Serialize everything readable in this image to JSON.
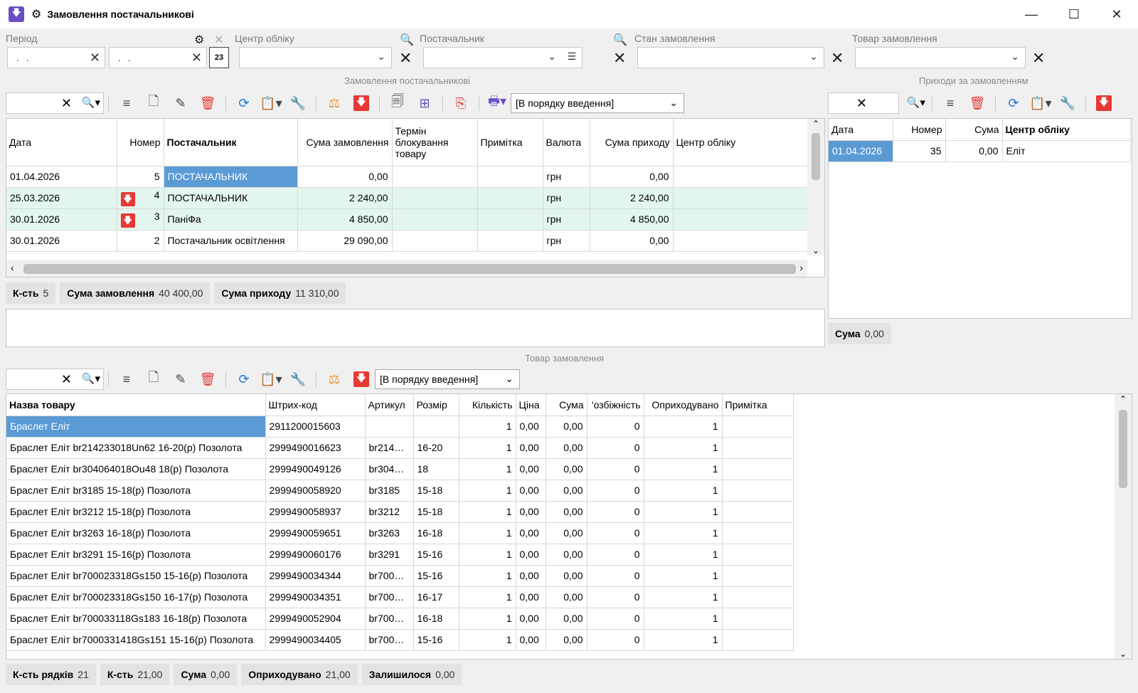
{
  "window": {
    "title": "Замовлення постачальникові",
    "minimize": "—",
    "maximize": "☐",
    "close": "✕"
  },
  "filters": {
    "period_label": "Період",
    "date_from": ". .",
    "date_to": ". .",
    "center_label": "Центр обліку",
    "supplier_label": "Постачальник",
    "state_label": "Стан замовлення",
    "item_label": "Товар замовлення"
  },
  "orders": {
    "section_title": "Замовлення постачальникові",
    "sort_value": "[В порядку введення]",
    "columns": [
      "Дата",
      "Номер",
      "Постачальник",
      "Сума замовлення",
      "Термін блокування товару",
      "Примітка",
      "Валюта",
      "Сума приходу",
      "Центр обліку"
    ],
    "rows": [
      {
        "date": "01.04.2026",
        "marker": "",
        "num": "5",
        "supplier": "ПОСТАЧАЛЬНИК",
        "sum": "0,00",
        "term": "",
        "note": "",
        "currency": "грн",
        "income": "0,00",
        "center": ""
      },
      {
        "date": "25.03.2026",
        "marker": "🡇",
        "num": "4",
        "supplier": "ПОСТАЧАЛЬНИК",
        "sum": "2 240,00",
        "term": "",
        "note": "",
        "currency": "грн",
        "income": "2 240,00",
        "center": ""
      },
      {
        "date": "30.01.2026",
        "marker": "🡇",
        "num": "3",
        "supplier": "ПаніФа",
        "sum": "4 850,00",
        "term": "",
        "note": "",
        "currency": "грн",
        "income": "4 850,00",
        "center": ""
      },
      {
        "date": "30.01.2026",
        "marker": "",
        "num": "2",
        "supplier": "Постачальник освітлення",
        "sum": "29 090,00",
        "term": "",
        "note": "",
        "currency": "грн",
        "income": "0,00",
        "center": ""
      }
    ],
    "footer": {
      "count_label": "К-сть",
      "count": "5",
      "sum_label": "Сума замовлення",
      "sum": "40 400,00",
      "income_label": "Сума приходу",
      "income": "11 310,00"
    }
  },
  "receipts": {
    "section_title": "Приходи за замовленням",
    "columns": [
      "Дата",
      "Номер",
      "Сума",
      "Центр обліку"
    ],
    "rows": [
      {
        "date": "01.04.2026",
        "num": "35",
        "sum": "0,00",
        "center": "Еліт"
      }
    ],
    "footer": {
      "sum_label": "Сума",
      "sum": "0,00"
    }
  },
  "items": {
    "section_title": "Товар замовлення",
    "sort_value": "[В порядку введення]",
    "columns": [
      "Назва товару",
      "Штрих-код",
      "Артикул",
      "Розмір",
      "Кількість",
      "Ціна",
      "Сума",
      "'озбіжність",
      "Оприходувано",
      "Примітка"
    ],
    "rows": [
      {
        "name": "Браслет Еліт",
        "barcode": "2911200015603",
        "article": "",
        "size": "",
        "qty": "1",
        "price": "0,00",
        "sum": "0,00",
        "diff": "0",
        "received": "1",
        "note": ""
      },
      {
        "name": "Браслет Еліт br214233018Un62 16-20(р) Позолота",
        "barcode": "2999490016623",
        "article": "br214…",
        "size": "16-20",
        "qty": "1",
        "price": "0,00",
        "sum": "0,00",
        "diff": "0",
        "received": "1",
        "note": ""
      },
      {
        "name": "Браслет Еліт br304064018Ou48 18(р) Позолота",
        "barcode": "2999490049126",
        "article": "br304…",
        "size": "18",
        "qty": "1",
        "price": "0,00",
        "sum": "0,00",
        "diff": "0",
        "received": "1",
        "note": ""
      },
      {
        "name": "Браслет Еліт br3185 15-18(р) Позолота",
        "barcode": "2999490058920",
        "article": "br3185",
        "size": "15-18",
        "qty": "1",
        "price": "0,00",
        "sum": "0,00",
        "diff": "0",
        "received": "1",
        "note": ""
      },
      {
        "name": "Браслет Еліт br3212 15-18(р) Позолота",
        "barcode": "2999490058937",
        "article": "br3212",
        "size": "15-18",
        "qty": "1",
        "price": "0,00",
        "sum": "0,00",
        "diff": "0",
        "received": "1",
        "note": ""
      },
      {
        "name": "Браслет Еліт br3263 16-18(р) Позолота",
        "barcode": "2999490059651",
        "article": "br3263",
        "size": "16-18",
        "qty": "1",
        "price": "0,00",
        "sum": "0,00",
        "diff": "0",
        "received": "1",
        "note": ""
      },
      {
        "name": "Браслет Еліт br3291 15-16(р) Позолота",
        "barcode": "2999490060176",
        "article": "br3291",
        "size": "15-16",
        "qty": "1",
        "price": "0,00",
        "sum": "0,00",
        "diff": "0",
        "received": "1",
        "note": ""
      },
      {
        "name": "Браслет Еліт br700023318Gs150 15-16(р) Позолота",
        "barcode": "2999490034344",
        "article": "br700…",
        "size": "15-16",
        "qty": "1",
        "price": "0,00",
        "sum": "0,00",
        "diff": "0",
        "received": "1",
        "note": ""
      },
      {
        "name": "Браслет Еліт br700023318Gs150 16-17(р) Позолота",
        "barcode": "2999490034351",
        "article": "br700…",
        "size": "16-17",
        "qty": "1",
        "price": "0,00",
        "sum": "0,00",
        "diff": "0",
        "received": "1",
        "note": ""
      },
      {
        "name": "Браслет Еліт br700033118Gs183 16-18(р) Позолота",
        "barcode": "2999490052904",
        "article": "br700…",
        "size": "16-18",
        "qty": "1",
        "price": "0,00",
        "sum": "0,00",
        "diff": "0",
        "received": "1",
        "note": ""
      },
      {
        "name": "Браслет Еліт br7000331418Gs151 15-16(р) Позолота",
        "barcode": "2999490034405",
        "article": "br700…",
        "size": "15-16",
        "qty": "1",
        "price": "0,00",
        "sum": "0,00",
        "diff": "0",
        "received": "1",
        "note": ""
      }
    ],
    "footer": {
      "rows_label": "К-сть рядків",
      "rows": "21",
      "qty_label": "К-сть",
      "qty": "21,00",
      "sum_label": "Сума",
      "sum": "0,00",
      "received_label": "Оприходувано",
      "received": "21,00",
      "left_label": "Залишилося",
      "left": "0,00"
    }
  },
  "colors": {
    "selection": "#5b9bd5",
    "green_row": "#e3f6ee",
    "accent_red": "#e53935",
    "app_purple": "#6a4fc4"
  }
}
